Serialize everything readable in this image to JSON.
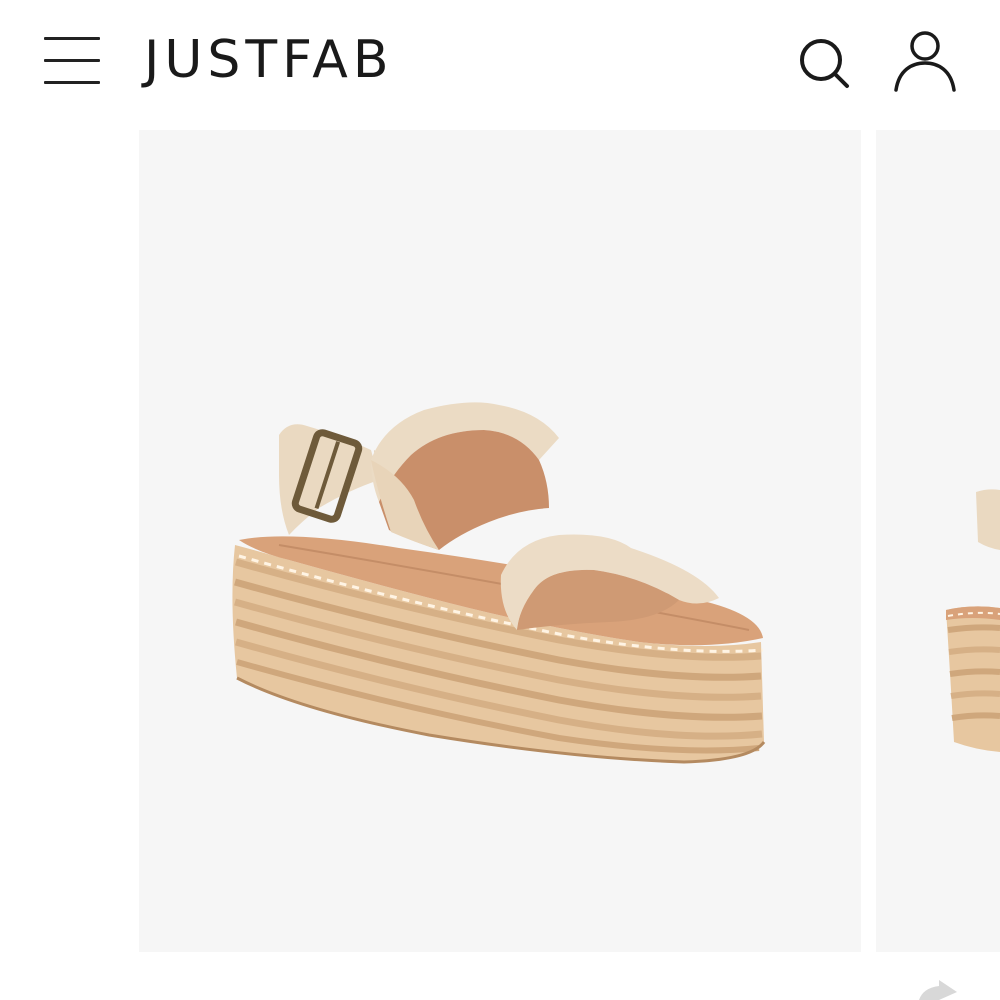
{
  "header": {
    "brand": "JUSTFAB",
    "icons": {
      "menu": "hamburger-menu-icon",
      "search": "search-icon",
      "account": "user-account-icon"
    }
  },
  "product_gallery": {
    "slides": [
      {
        "image": "espadrille-platform-sandal",
        "view": "three-quarter"
      },
      {
        "image": "espadrille-platform-sandal",
        "view": "side"
      }
    ]
  },
  "colors": {
    "background": "#ffffff",
    "image_background": "#f6f6f6",
    "text": "#1a1a1a"
  }
}
